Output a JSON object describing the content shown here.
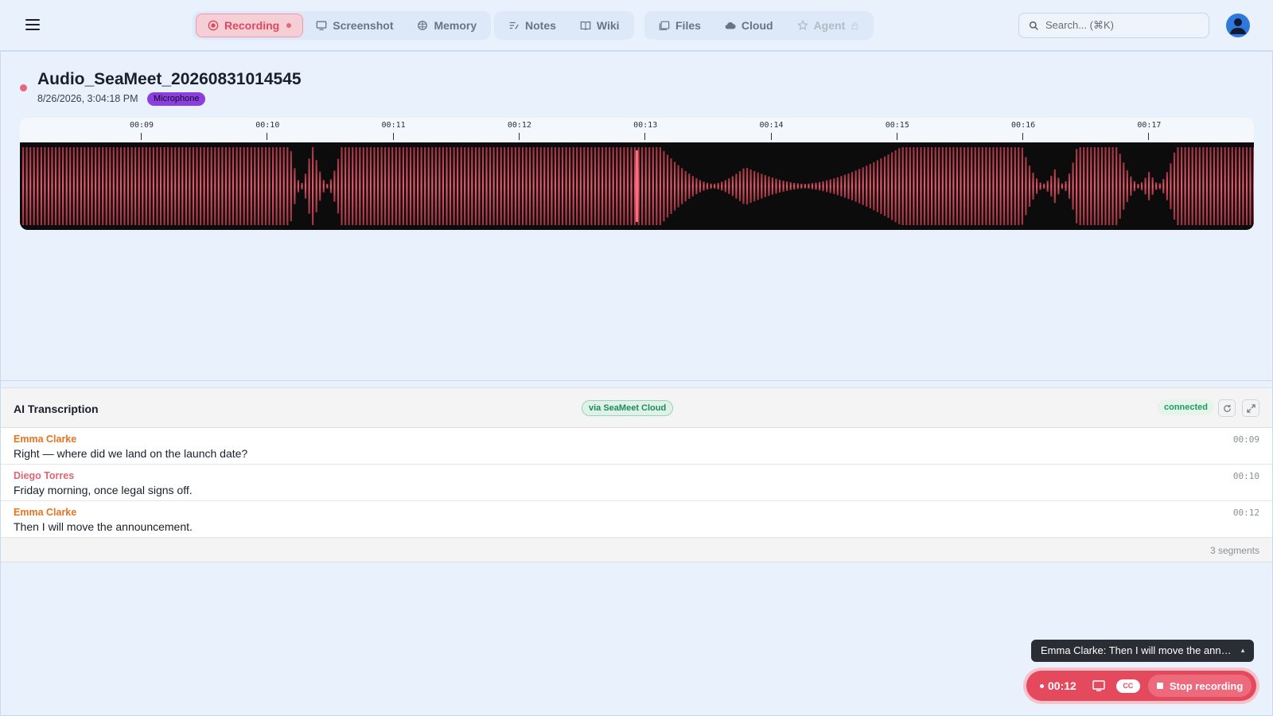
{
  "nav": {
    "groups": [
      [
        {
          "label": "Recording",
          "icon": "record-icon",
          "active": true
        },
        {
          "label": "Screenshot",
          "icon": "monitor-icon"
        },
        {
          "label": "Memory",
          "icon": "brain-icon"
        }
      ],
      [
        {
          "label": "Notes",
          "icon": "notes-icon"
        },
        {
          "label": "Wiki",
          "icon": "book-icon"
        }
      ],
      [
        {
          "label": "Files",
          "icon": "files-icon"
        },
        {
          "label": "Cloud",
          "icon": "cloud-icon"
        },
        {
          "label": "Agent",
          "icon": "agent-icon",
          "disabled": true
        }
      ]
    ],
    "search_placeholder": "Search... (⌘K)"
  },
  "recording": {
    "title": "Audio_SeaMeet_20260831014545",
    "datetime": "8/26/2026, 3:04:18 PM",
    "source_badge": "Microphone"
  },
  "waveform": {
    "ticks": [
      "00:09",
      "00:10",
      "00:11",
      "00:12",
      "00:13",
      "00:14",
      "00:15",
      "00:16",
      "00:17"
    ],
    "playhead_time": "00:12",
    "wave_color": "#e8596b"
  },
  "transcription": {
    "title": "AI Transcription",
    "via_badge": "via SeaMeet Cloud",
    "status": "connected",
    "segments": [
      {
        "speaker": "Emma Clarke",
        "text": "Right — where did we land on the launch date?",
        "time": "00:09",
        "color": "#e8731f"
      },
      {
        "speaker": "Diego Torres",
        "text": "Friday morning, once legal signs off.",
        "time": "00:10",
        "color": "#e06472"
      },
      {
        "speaker": "Emma Clarke",
        "text": "Then I will move the announcement.",
        "time": "00:12",
        "color": "#e8731f"
      }
    ],
    "footer": "3 segments"
  },
  "recorder": {
    "caption": "Emma Clarke: Then I will move the announcement.",
    "elapsed": "00:12",
    "cc_label": "CC",
    "stop_label": "Stop recording"
  }
}
